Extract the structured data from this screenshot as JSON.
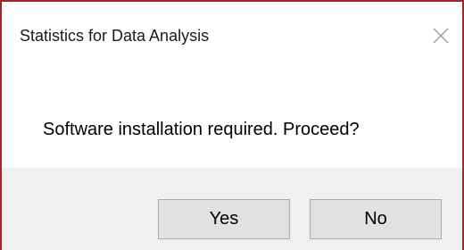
{
  "dialog": {
    "title": "Statistics for Data Analysis",
    "message": "Software installation required. Proceed?",
    "close_icon": "close-icon",
    "buttons": {
      "yes_label": "Yes",
      "no_label": "No"
    },
    "colors": {
      "border": "#a4262c",
      "footer_background": "#f0f0f0",
      "button_background": "#e1e1e1",
      "button_border": "#adadad"
    }
  }
}
